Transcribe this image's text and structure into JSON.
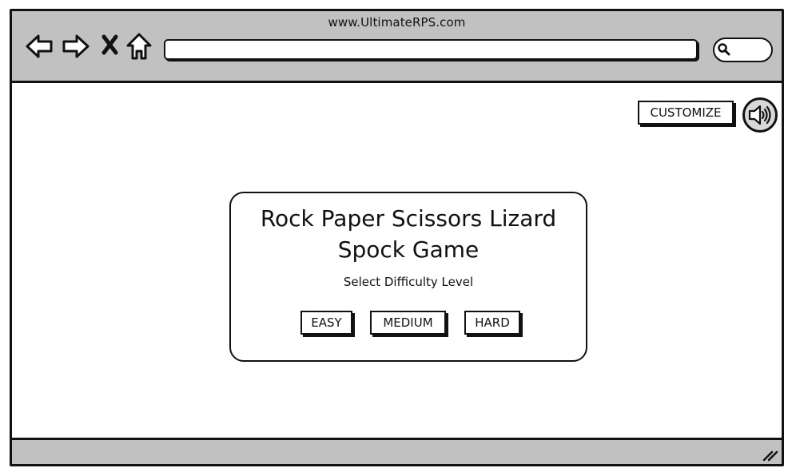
{
  "browser": {
    "url": "www.UltimateRPS.com",
    "nav_icons": [
      "back-arrow-icon",
      "forward-arrow-icon",
      "close-x-icon",
      "home-icon"
    ],
    "address_value": "",
    "search_icon": "search-icon"
  },
  "toolbar": {
    "customize_label": "CUSTOMIZE",
    "sound_icon": "speaker-icon"
  },
  "game": {
    "title": "Rock Paper Scissors Lizard Spock Game",
    "subtitle": "Select Difficulty Level",
    "difficulty_buttons": {
      "easy": "EASY",
      "medium": "MEDIUM",
      "hard": "HARD"
    }
  },
  "colors": {
    "chrome": "#c1c1c1",
    "outline": "#111111",
    "background": "#ffffff"
  }
}
